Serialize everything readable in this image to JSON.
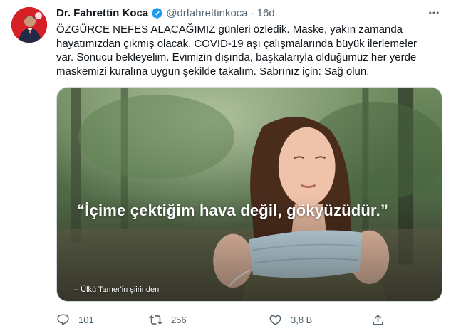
{
  "tweet": {
    "author_name": "Dr. Fahrettin Koca",
    "handle": "@drfahrettinkoca",
    "separator": "·",
    "time": "16d",
    "text": "ÖZGÜRCE NEFES ALACAĞIMIZ günleri özledik. Maske, yakın zamanda hayatımızdan çıkmış olacak. COVID-19 aşı çalışmalarında büyük ilerlemeler var. Sonucu bekleyelim. Evimizin dışında, başkalarıyla olduğumuz her yerde maskemizi kuralına uygun şekilde takalım. Sabrınız için: Sağ olun.",
    "media": {
      "quote": "“İçime çektiğim hava değil, gökyüzüdür.”",
      "credit": "– Ülkü Tamer'in şiirinden"
    },
    "actions": {
      "reply_count": "101",
      "retweet_count": "256",
      "like_count": "3,8 B"
    }
  },
  "icons": {
    "avatar": "profile-photo",
    "verified": "verified-badge-icon",
    "more": "more-horizontal-icon",
    "reply": "reply-bubble-icon",
    "retweet": "retweet-icon",
    "like": "heart-icon",
    "share": "share-icon"
  },
  "colors": {
    "text": "#0f1419",
    "secondary": "#536471",
    "verified": "#1d9bf0",
    "avatar_bg": "#c9141b"
  }
}
